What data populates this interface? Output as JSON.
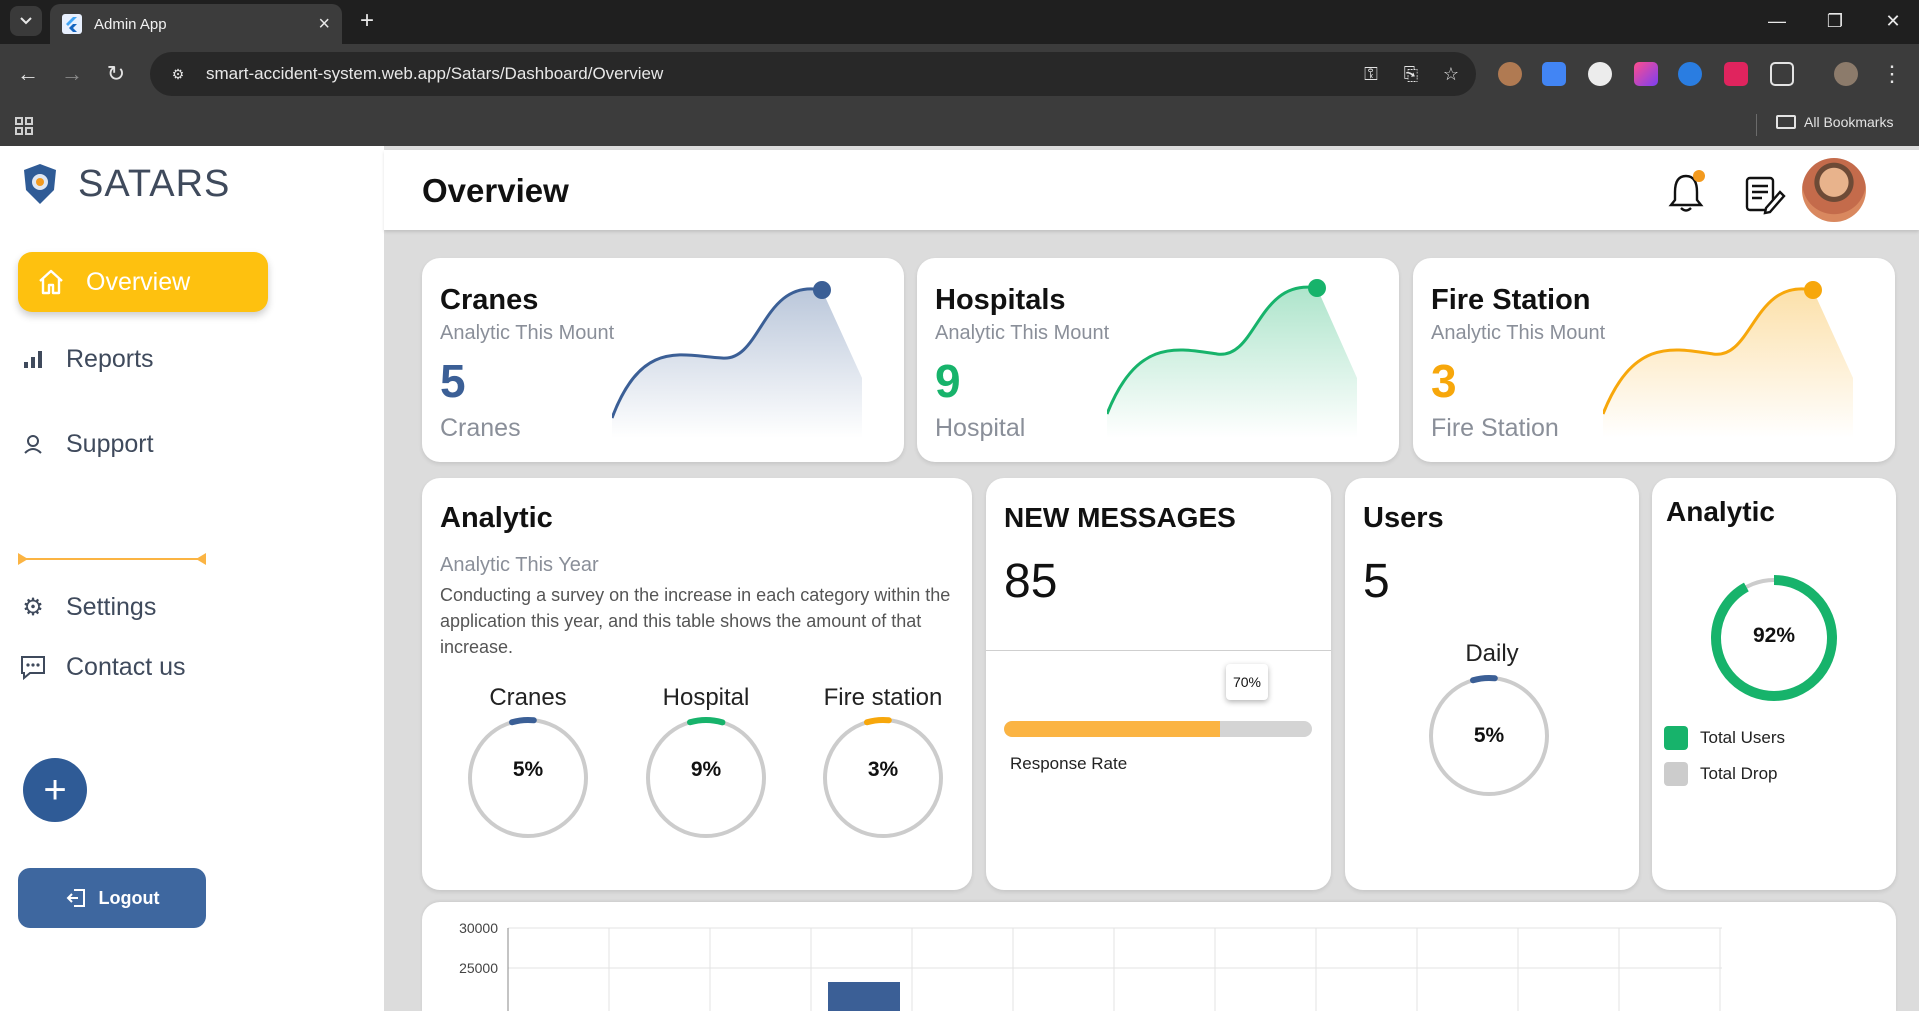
{
  "browser": {
    "tab_title": "Admin App",
    "url": "smart-accident-system.web.app/Satars/Dashboard/Overview",
    "all_bookmarks": "All Bookmarks"
  },
  "sidebar": {
    "brand": "SATARS",
    "active_item": "Overview",
    "items": [
      "Reports",
      "Support",
      "Settings",
      "Contact us"
    ],
    "logout": "Logout",
    "accent_color": "#fec10f"
  },
  "header": {
    "title": "Overview"
  },
  "kpis": [
    {
      "title": "Cranes",
      "subtitle": "Analytic This Mount",
      "value": "5",
      "unit": "Cranes",
      "color": "#3b5f96"
    },
    {
      "title": "Hospitals",
      "subtitle": "Analytic This Mount",
      "value": "9",
      "unit": "Hospital",
      "color": "#17b36b"
    },
    {
      "title": "Fire Station",
      "subtitle": "Analytic This Mount",
      "value": "3",
      "unit": "Fire Station",
      "color": "#f7a70b"
    }
  ],
  "analytic": {
    "title": "Analytic",
    "subtitle": "Analytic This Year",
    "description": "Conducting a survey on the increase in each category within the application this year, and this table shows the amount of that increase.",
    "gauges": [
      {
        "label": "Cranes",
        "value": "5%",
        "percent": 5,
        "color": "#3b5f96"
      },
      {
        "label": "Hospital",
        "value": "9%",
        "percent": 9,
        "color": "#17b36b"
      },
      {
        "label": "Fire station",
        "value": "3%",
        "percent": 3,
        "color": "#f7a70b"
      }
    ]
  },
  "messages": {
    "title": "NEW MESSAGES",
    "count": "85",
    "tooltip": "70%",
    "response_rate": 70,
    "bar_label": "Response Rate"
  },
  "users": {
    "title": "Users",
    "count": "5",
    "daily_label": "Daily",
    "daily_value": "5%",
    "daily_percent": 5
  },
  "donut": {
    "title": "Analytic",
    "value": "92%",
    "percent": 92,
    "legend": [
      "Total Users",
      "Total Drop"
    ],
    "colors": [
      "#17b36b",
      "#cccccc"
    ]
  },
  "chart_data": {
    "type": "bar",
    "yticks": [
      "30000",
      "25000"
    ],
    "ylim": [
      25000,
      30000
    ]
  }
}
